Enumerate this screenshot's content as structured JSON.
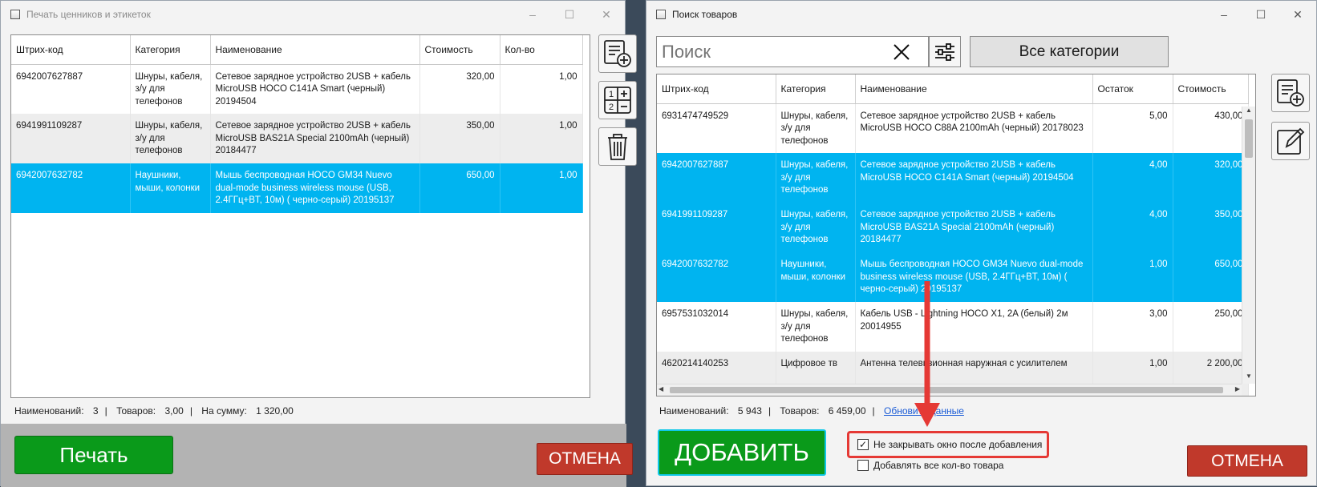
{
  "win1": {
    "title": "Печать ценников и этикеток",
    "columns": [
      "Штрих-код",
      "Категория",
      "Наименование",
      "Стоимость",
      "Кол-во"
    ],
    "rows": [
      [
        "6942007627887",
        "Шнуры, кабеля, з/у для телефонов",
        "Сетевое зарядное устройство 2USB + кабель MicroUSB HOCO C141A Smart (черный) 20194504",
        "320,00",
        "1,00"
      ],
      [
        "6941991109287",
        "Шнуры, кабеля, з/у для телефонов",
        "Сетевое зарядное устройство 2USB + кабель MicroUSB BAS21A Special 2100mAh (черный) 20184477",
        "350,00",
        "1,00"
      ],
      [
        "6942007632782",
        "Наушники, мыши, колонки",
        "Мышь беспроводная HOCO GM34 Nuevo dual-mode business wireless mouse (USB, 2.4ГГц+BT, 10м) ( черно-серый) 20195137",
        "650,00",
        "1,00"
      ]
    ],
    "selected_row": 3,
    "status": {
      "names_label": "Наименований:",
      "names_value": "3",
      "goods_label": "Товаров:",
      "goods_value": "3,00",
      "sum_label": "На сумму:",
      "sum_value": "1 320,00"
    },
    "print_label": "Печать",
    "cancel_label": "ОТМЕНА"
  },
  "win2": {
    "title": "Поиск товаров",
    "search_placeholder": "Поиск",
    "categories_label": "Все категории",
    "columns": [
      "Штрих-код",
      "Категория",
      "Наименование",
      "Остаток",
      "Стоимость"
    ],
    "rows": [
      [
        "6931474749529",
        "Шнуры, кабеля, з/у для телефонов",
        "Сетевое зарядное устройство 2USB + кабель MicroUSB HOCO C88A 2100mAh (черный) 20178023",
        "5,00",
        "430,00"
      ],
      [
        "6942007627887",
        "Шнуры, кабеля, з/у для телефонов",
        "Сетевое зарядное устройство 2USB + кабель MicroUSB HOCO C141A Smart (черный) 20194504",
        "4,00",
        "320,00"
      ],
      [
        "6941991109287",
        "Шнуры, кабеля, з/у для телефонов",
        "Сетевое зарядное устройство 2USB + кабель MicroUSB BAS21A Special 2100mAh (черный) 20184477",
        "4,00",
        "350,00"
      ],
      [
        "6942007632782",
        "Наушники, мыши, колонки",
        "Мышь беспроводная HOCO GM34 Nuevo dual-mode business wireless mouse (USB, 2.4ГГц+BT, 10м) ( черно-серый) 20195137",
        "1,00",
        "650,00"
      ],
      [
        "6957531032014",
        "Шнуры, кабеля, з/у для телефонов",
        "Кабель USB - Lightning HOCO X1, 2A (белый) 2м 20014955",
        "3,00",
        "250,00"
      ],
      [
        "4620214140253",
        "Цифровое тв",
        "Антенна телевизионная наружная с усилителем",
        "1,00",
        "2 200,00"
      ]
    ],
    "selected_rows": [
      2,
      3,
      4
    ],
    "status": {
      "names_label": "Наименований:",
      "names_value": "5 943",
      "goods_label": "Товаров:",
      "goods_value": "6 459,00",
      "refresh_label": "Обновить данные"
    },
    "add_label": "ДОБАВИТЬ",
    "keep_open_label": "Не закрывать окно после добавления",
    "keep_open_checked": true,
    "add_all_label": "Добавлять все кол-во товара",
    "add_all_checked": false,
    "cancel_label": "ОТМЕНА"
  },
  "colors": {
    "selection": "#00b4f0",
    "green_button": "#0a9a1a",
    "red_button": "#c0392b",
    "annotation": "#e53935"
  },
  "icons": [
    "window-icon",
    "add-document-icon",
    "calculator-icon",
    "trash-icon",
    "clear-icon",
    "filter-icon",
    "edit-icon",
    "checkbox-icon"
  ]
}
